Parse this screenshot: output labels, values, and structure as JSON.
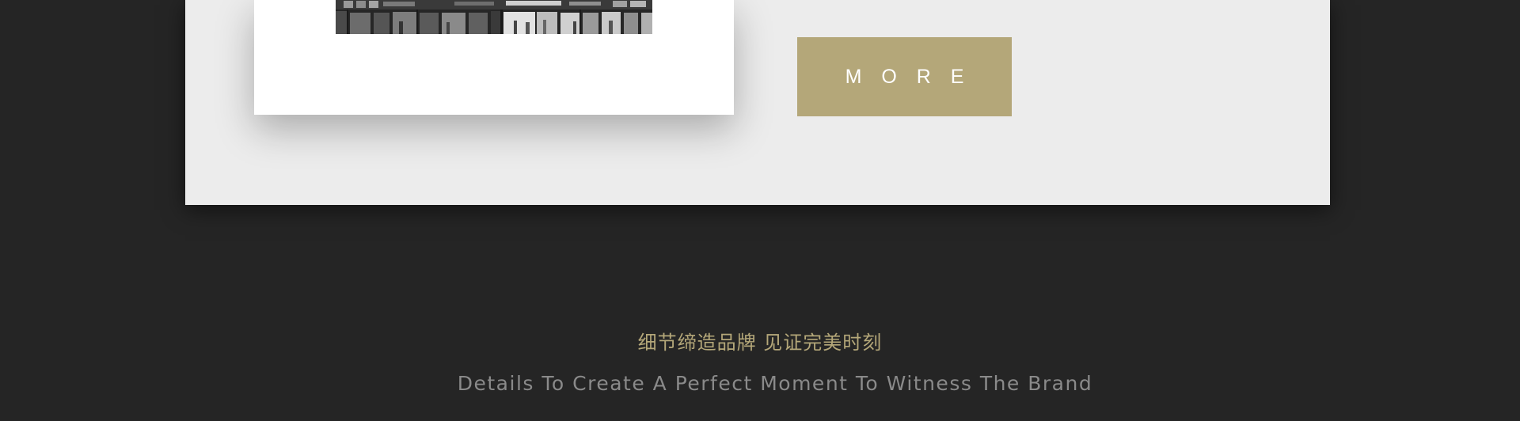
{
  "feature": {
    "photo_alt": "Black and white storefront photo",
    "more_button_label": "M O R E"
  },
  "footer": {
    "slogan_cn": "细节缔造品牌 见证完美时刻",
    "slogan_en": "Details To Create A Perfect Moment To Witness The Brand"
  },
  "colors": {
    "page_background": "#252525",
    "panel_background": "#ececec",
    "accent_gold": "#b4a779",
    "slogan_en_gray": "#8a8a8a"
  }
}
